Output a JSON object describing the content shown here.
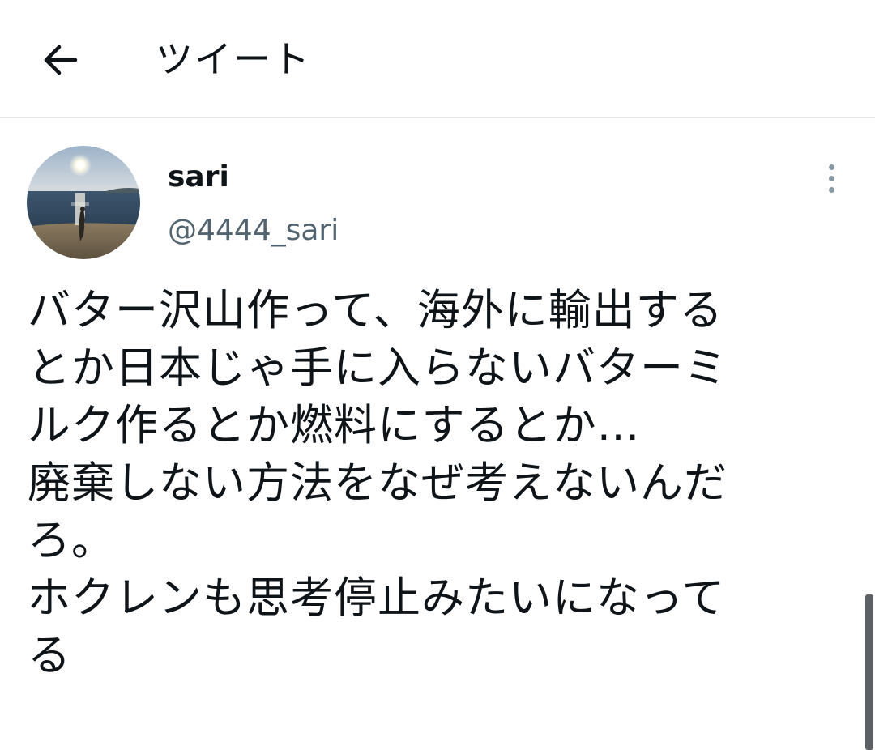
{
  "header": {
    "back_icon": "arrow-left-icon",
    "title": "ツイート"
  },
  "tweet": {
    "author": {
      "name": "sari",
      "handle": "@4444_sari",
      "avatar": "sunset-beach-photo"
    },
    "more_icon": "more-vertical-icon",
    "text": "バター沢山作って、海外に輸出する\nとか日本じゃ手に入らないバターミ\nルク作るとか燃料にするとか…\n廃棄しない方法をなぜ考えないんだ\nろ。\nホクレンも思考停止みたいになって\nる"
  },
  "colors": {
    "text": "#0f1419",
    "secondary_text": "#536471",
    "divider": "#e1e6ea"
  }
}
